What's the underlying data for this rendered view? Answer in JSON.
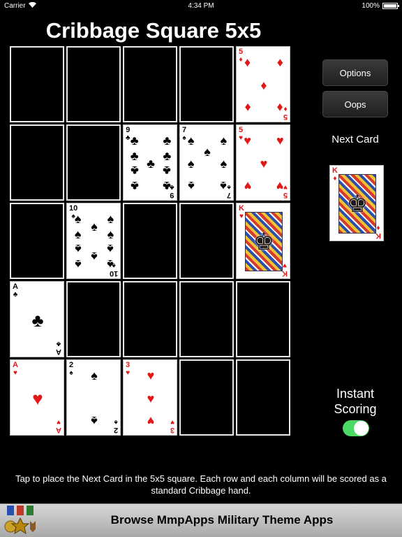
{
  "status_bar": {
    "carrier": "Carrier",
    "time": "4:34 PM",
    "battery": "100%"
  },
  "title": "Cribbage Square 5x5",
  "buttons": {
    "options": "Options",
    "oops": "Oops"
  },
  "next_card": {
    "label": "Next Card",
    "card": {
      "rank": "K",
      "suit": "♦",
      "color": "red"
    }
  },
  "instant_scoring": {
    "label": "Instant Scoring",
    "enabled": true
  },
  "instructions": "Tap to place the Next Card in the 5x5 square. Each row and each column will be scored as a standard Cribbage hand.",
  "banner": {
    "text": "Browse MmpApps Military Theme Apps"
  },
  "grid": {
    "rows": 5,
    "cols": 5,
    "cells": [
      null,
      null,
      null,
      null,
      {
        "rank": "5",
        "suit": "♦",
        "color": "red"
      },
      null,
      null,
      {
        "rank": "9",
        "suit": "♣",
        "color": "black"
      },
      {
        "rank": "7",
        "suit": "♠",
        "color": "black"
      },
      {
        "rank": "5",
        "suit": "♥",
        "color": "red"
      },
      null,
      {
        "rank": "10",
        "suit": "♠",
        "color": "black"
      },
      null,
      null,
      {
        "rank": "K",
        "suit": "♥",
        "color": "red"
      },
      {
        "rank": "A",
        "suit": "♣",
        "color": "black"
      },
      null,
      null,
      null,
      null,
      {
        "rank": "A",
        "suit": "♥",
        "color": "red"
      },
      {
        "rank": "2",
        "suit": "♠",
        "color": "black"
      },
      {
        "rank": "3",
        "suit": "♥",
        "color": "red"
      },
      null,
      null
    ]
  }
}
